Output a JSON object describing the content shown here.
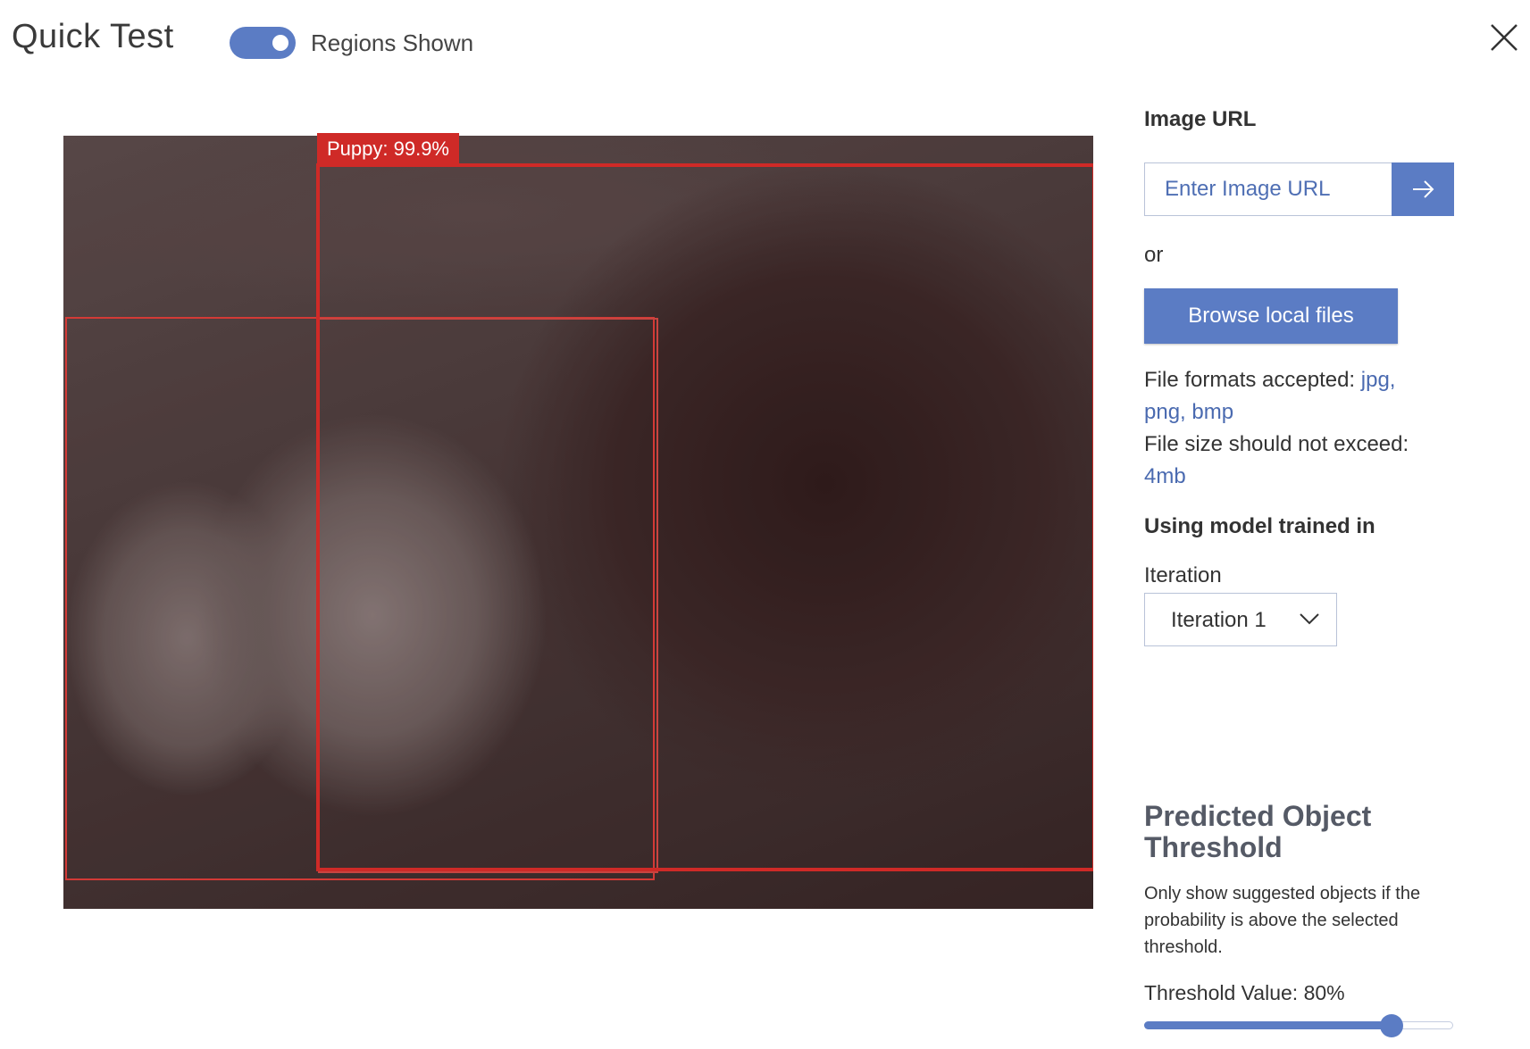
{
  "header": {
    "title": "Quick Test",
    "toggle_label": "Regions Shown",
    "toggle_on": true
  },
  "image_panel": {
    "region_label": "Puppy: 99.9%"
  },
  "sidebar": {
    "url_label": "Image URL",
    "url_placeholder": "Enter Image URL",
    "url_value": "",
    "or_text": "or",
    "browse_label": "Browse local files",
    "formats_prefix": "File formats accepted: ",
    "formats_list": "jpg, png, bmp",
    "size_prefix": "File size should not exceed: ",
    "size_value": "4mb",
    "model_label": "Using model trained in",
    "iteration_label": "Iteration",
    "iteration_selected": "Iteration 1"
  },
  "threshold": {
    "title": "Predicted Object Threshold",
    "description": "Only show suggested objects if the probability is above the selected threshold.",
    "value_text": "Threshold Value: 80%",
    "value": 80
  },
  "colors": {
    "accent": "#5b7cc4",
    "region_box": "#cf2a27",
    "link": "#4a6ab0"
  },
  "icons": {
    "close": "close-icon",
    "go": "arrow-right-icon",
    "dropdown": "chevron-down-icon"
  }
}
